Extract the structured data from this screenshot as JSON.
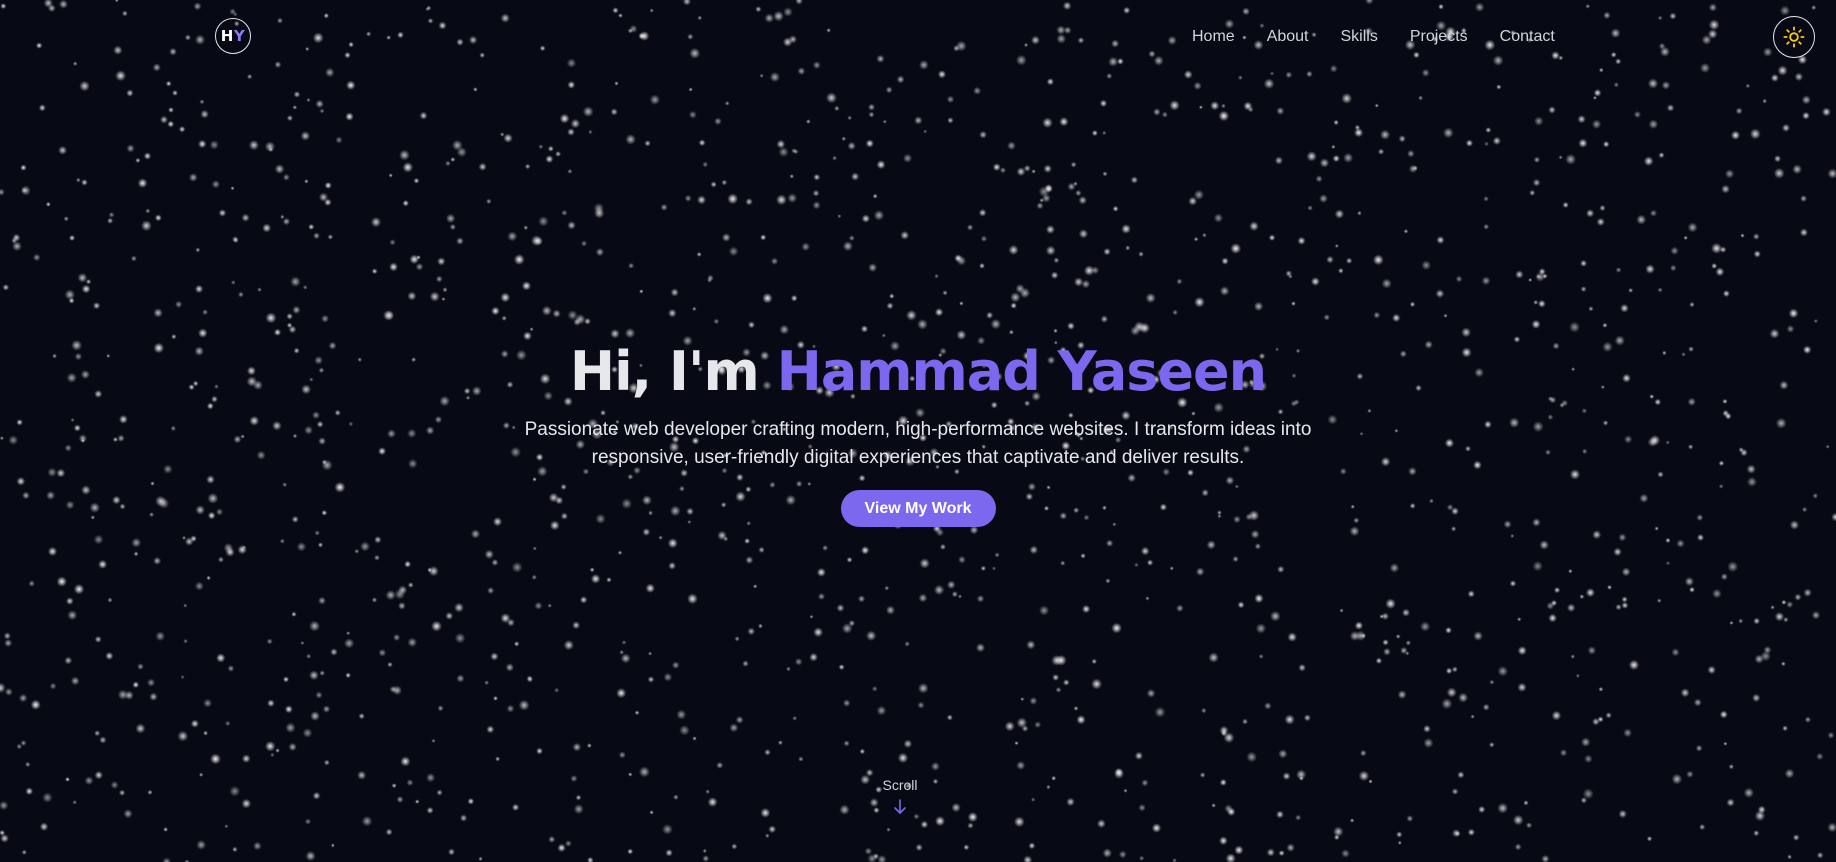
{
  "logo": {
    "initial_h": "H",
    "initial_y": "Y"
  },
  "nav": {
    "items": [
      "Home",
      "About",
      "Skills",
      "Projects",
      "Contact"
    ]
  },
  "theme_toggle": {
    "icon": "sun-icon",
    "color": "#facc15"
  },
  "hero": {
    "greeting": "Hi, I'm",
    "name": "Hammad Yaseen",
    "description": "Passionate web developer crafting modern, high-performance websites. I transform ideas into responsive, user-friendly digital experiences that captivate and deliver results.",
    "cta_label": "View My Work"
  },
  "scroll": {
    "label": "Scroll",
    "icon": "arrow-down-icon"
  },
  "colors": {
    "background": "#070a14",
    "accent": "#7b68ee",
    "text": "#e5e7eb",
    "star": "#ffffff"
  }
}
